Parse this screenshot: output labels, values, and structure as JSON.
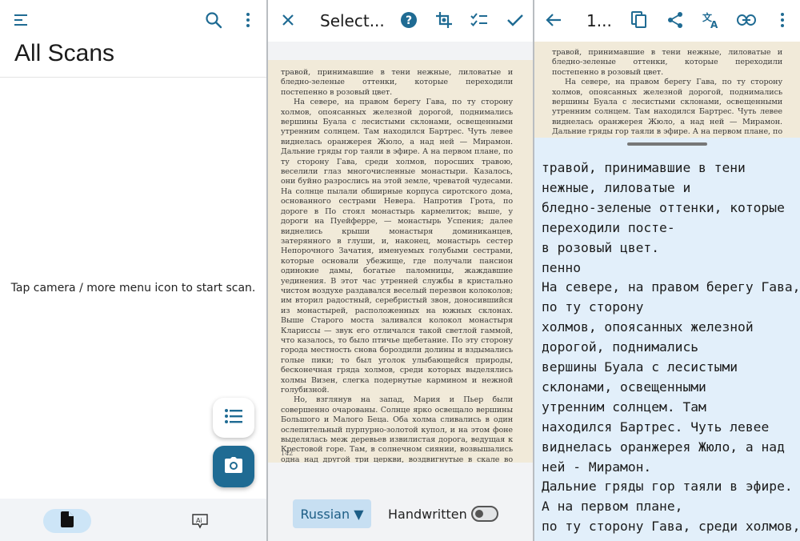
{
  "panel_all_scans": {
    "title": "All Scans",
    "empty_message": "Tap camera / more menu icon to start scan.",
    "icons": {
      "menu": "menu-icon",
      "search": "search-icon",
      "more": "more-vert-icon",
      "list": "list-icon",
      "camera": "camera-icon",
      "nav_scans": "document-icon",
      "nav_ai": "ai-text-icon"
    },
    "colors": {
      "accent": "#1f6b93",
      "nav_selected": "#cde5f7"
    }
  },
  "panel_select": {
    "title": "Select...",
    "language": "Russian ▼",
    "handwritten_label": "Handwritten",
    "handwritten_on": false,
    "icons": {
      "close": "close-icon",
      "help": "help-icon",
      "crop": "crop-icon",
      "checklist": "checklist-icon",
      "confirm": "check-icon"
    },
    "page_number": "142",
    "scan_paragraphs": [
      "травой, принимавшие в тени нежные, лиловатые и бледно-зеленые оттенки, которые переходили постепенно в розовый цвет.",
      "На севере, на правом берегу Гава, по ту сторону холмов, опоясанных железной дорогой, поднимались вершины Буала с лесистыми склонами, освещенными утренним солнцем. Там находился Бартрес. Чуть левее виднелась оранжерея Жюло, а над ней — Мирамон. Дальние гряды гор таяли в эфире. А на первом плане, по ту сторону Гава, среди холмов, поросших травою, веселили глаз многочисленные монастыри. Казалось, они буйно разрослись на этой земле, чреватой чудесами. На солнце пылали обширные корпуса сиротского дома, основанного сестрами Невера. Напротив Грота, по дороге в По стоял монастырь кармелиток; выше, у дороги на Пуейферре, — монастырь Успения; далее виднелись крыши монастыря доминиканцев, затерянного в глуши, и, наконец, монастырь сестер Непорочного Зачатия, именуемых голубыми сестрами, которые основали убежище, где получали пансион одинокие дамы, богатые паломницы, жаждавшие уединения. В этот час утренней службы в кристально чистом воздухе раздавался веселый перезвон колоколов; им вторил радостный, серебристый звон, доносившийся из монастырей, расположенных на южных склонах. Выше Старого моста заливался колокол монастыря Клариссы — звук его отличался такой светлой гаммой, что казалось, то было птичье щебетание. По эту сторону города местность снова бороздили долины и вздымались голые пики; то был уголок улыбающейся природы, бесконечная гряда холмов, среди которых выделялись холмы Визен, слегка подернутые кармином и нежной голубизной.",
      "Но, взглянув на запад, Мария и Пьер были совершенно очарованы. Солнце ярко освещало вершины Большого и Малого Беца. Оба холма сливались в один ослепительный пурпурно-золотой купол, и на этом фоне выделялась меж деревьев извилистая дорога, ведущая к Крестовой горе. Там, в солнечном сиянии, возвышались одна над другой три церкви, воздвигнутые в скале во славу святой девы, по нежному призыву"
    ]
  },
  "panel_result": {
    "title": "1...",
    "icons": {
      "back": "arrow-back-icon",
      "copy": "copy-icon",
      "share": "share-icon",
      "translate": "translate-icon",
      "link": "link-icon",
      "more": "more-vert-icon"
    },
    "preview_paragraphs": [
      "травой, принимавшие в тени нежные, лиловатые и бледно-зеленые оттенки, которые переходили постепенно в розовый цвет.",
      "На севере, на правом берегу Гава, по ту сторону холмов, опоясанных железной дорогой, поднимались вершины Буала с лесистыми склонами, освещенными утренним солнцем. Там находился Бартрес. Чуть левее виднелась оранжерея Жюло, а над ней — Мирамон. Дальние гряды гор таяли в эфире. А на первом плане, по ту сторону Гава, среди холмов, поросших травою"
    ],
    "ocr_lines": [
      "травой, принимавшие в тени",
      "нежные, лиловатые и",
      "бледно-зеленые оттенки, которые",
      "переходили посте-",
      "в розовый цвет.",
      "пенно",
      "На севере, на правом берегу Гава,",
      "по ту сторону",
      "холмов, опоясанных железной",
      "дорогой, поднимались",
      "вершины Буала с лесистыми",
      "склонами, освещенными",
      "утренним солнцем. Там",
      "находился Бартрес. Чуть левее",
      "виднелась оранжерея Жюло, а над",
      "ней - Мирамон.",
      "Дальние гряды гор таяли в эфире.",
      "А на первом плане,",
      "по ту сторону Гава, среди холмов,"
    ],
    "colors": {
      "ocr_background": "#e2effa"
    }
  }
}
